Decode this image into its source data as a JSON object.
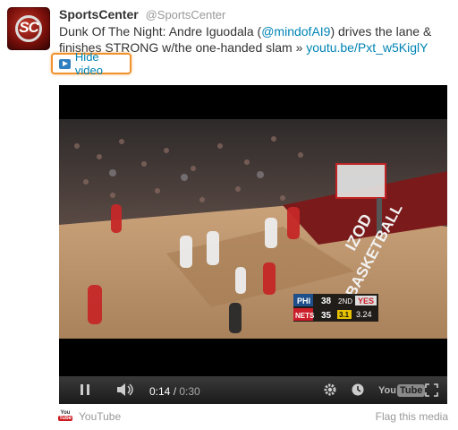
{
  "tweet": {
    "display_name": "SportsCenter",
    "handle": "@SportsCenter",
    "avatar_text": "SC",
    "text_before_mention": "Dunk Of The Night: Andre Iguodala (",
    "mention": "@mindofAI9",
    "text_after_mention": ") drives the lane & finishes STRONG w/the one-handed slam » ",
    "link": "youtu.be/Pxt_w5KiglY",
    "hide_video_label": "Hide video"
  },
  "scoreboard": {
    "team1": "PHI",
    "team1_score": "38",
    "period": "2ND",
    "network": "YES",
    "team2": "NETS",
    "team2_score": "35",
    "shot_clock": "3.1",
    "game_clock": "3.24"
  },
  "court_text": {
    "baseline": "BASKETBALL",
    "side": "IZOD"
  },
  "player_controls": {
    "current_time": "0:14",
    "separator": " / ",
    "total_time": "0:30",
    "progress": 0.47,
    "youtube_label_left": "You",
    "youtube_label_right": "Tube"
  },
  "footer": {
    "source_label": "YouTube",
    "flag_label": "Flag this media",
    "logo_you": "You",
    "logo_tube": "Tube"
  },
  "colors": {
    "link": "#0084b4",
    "highlight": "#f0922e",
    "youtube_red": "#cc181e",
    "player_bg": "#000000"
  }
}
